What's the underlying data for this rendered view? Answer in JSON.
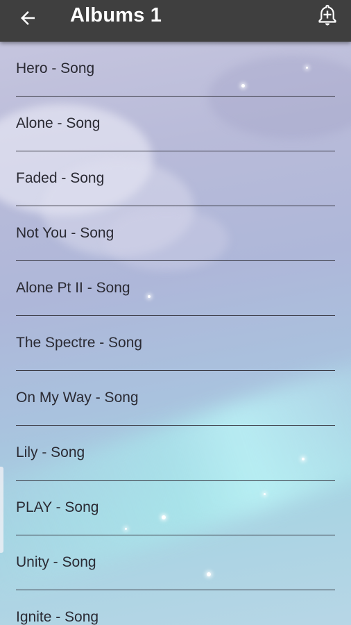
{
  "header": {
    "title": "Albums 1",
    "back_icon": "arrow-left-icon",
    "action_icon": "add-alarm-bell-icon",
    "background_color": "#3f3f3f"
  },
  "songs": [
    "Hero - Song",
    "Alone - Song",
    "Faded - Song",
    "Not You - Song",
    "Alone Pt II - Song",
    "The Spectre - Song",
    "On My Way - Song",
    "Lily - Song",
    "PLAY - Song",
    "Unity - Song",
    "Ignite - Song"
  ]
}
